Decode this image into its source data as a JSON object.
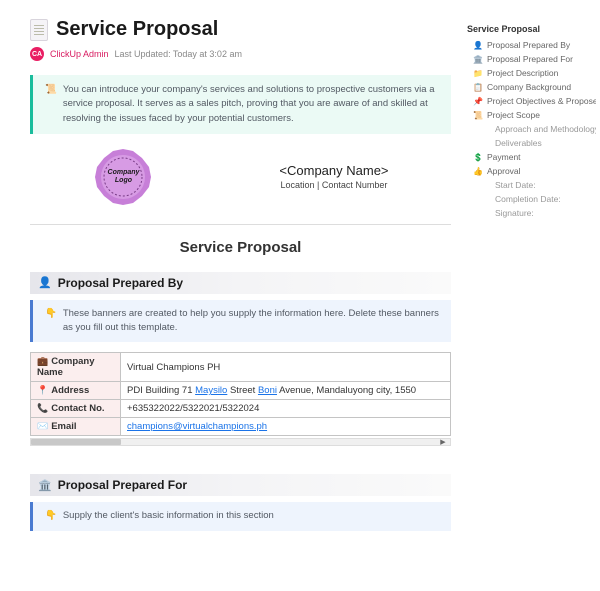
{
  "header": {
    "title": "Service Proposal",
    "author": "ClickUp Admin",
    "updated_label": "Last Updated: Today at 3:02 am",
    "avatar_initials": "CA"
  },
  "intro_banner": {
    "icon": "📜",
    "text": "You can introduce your company's services and solutions to prospective customers via a service proposal. It serves as a sales pitch, proving that you are aware of and skilled at resolving the issues faced by your potential customers."
  },
  "company": {
    "logo_line1": "Company",
    "logo_line2": "Logo",
    "name": "<Company Name>",
    "location": "Location | Contact Number"
  },
  "doc_title": "Service Proposal",
  "section1": {
    "icon": "👤",
    "title": "Proposal Prepared By",
    "banner_icon": "👇",
    "banner_text": "These banners are created to help you supply the information here. Delete these banners as you fill out this template."
  },
  "table": {
    "rows": [
      {
        "icon": "💼",
        "label": "Company Name",
        "value": "Virtual Champions PH",
        "link_parts": []
      },
      {
        "icon": "📍",
        "label": "Address",
        "value_parts": [
          "PDI Building 71 ",
          "Maysilo",
          " Street ",
          "Boni",
          " Avenue, Mandaluyong city, 1550"
        ]
      },
      {
        "icon": "📞",
        "label": "Contact No.",
        "value": "+635322022/5322021/5322024"
      },
      {
        "icon": "✉️",
        "label": "Email",
        "value": "champions@virtualchampions.ph",
        "is_link": true
      }
    ]
  },
  "section2": {
    "icon": "🏛️",
    "title": "Proposal Prepared For",
    "banner_icon": "👇",
    "banner_text": "Supply the client's basic information in this section"
  },
  "nav": {
    "title": "Service Proposal",
    "items": [
      {
        "icon": "👤",
        "label": "Proposal Prepared By"
      },
      {
        "icon": "🏛️",
        "label": "Proposal Prepared For"
      },
      {
        "icon": "📁",
        "label": "Project Description",
        "icon_color": "#f5a623"
      },
      {
        "icon": "📋",
        "label": "Company Background"
      },
      {
        "icon": "📌",
        "label": "Project Objectives & Proposed Ser...",
        "icon_color": "#e74c3c"
      },
      {
        "icon": "📜",
        "label": "Project Scope",
        "icon_color": "#f1c40f"
      },
      {
        "icon": "",
        "label": "Approach and Methodology",
        "sub": true
      },
      {
        "icon": "",
        "label": "Deliverables",
        "sub": true
      },
      {
        "icon": "💲",
        "label": "Payment",
        "icon_color": "#27ae60"
      },
      {
        "icon": "👍",
        "label": "Approval",
        "icon_color": "#f39c12"
      },
      {
        "icon": "",
        "label": "Start Date:",
        "sub": true
      },
      {
        "icon": "",
        "label": "Completion Date:",
        "sub": true
      },
      {
        "icon": "",
        "label": "Signature:",
        "sub": true
      }
    ]
  }
}
